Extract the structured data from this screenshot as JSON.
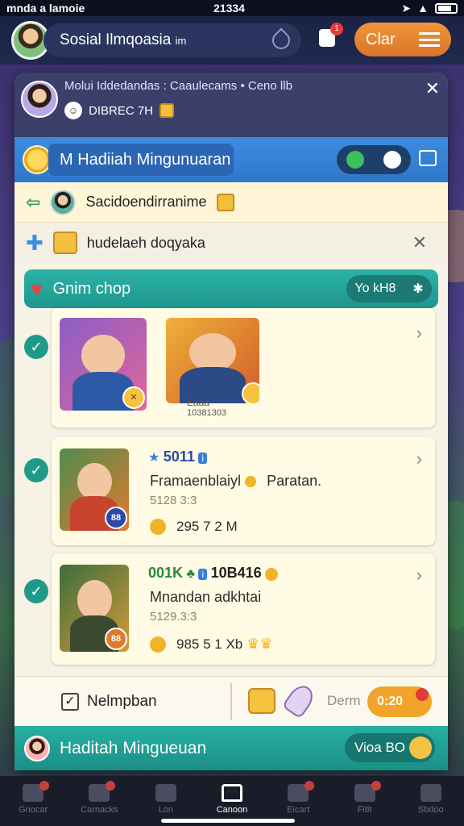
{
  "status_bar": {
    "left": "mnda a lamoie",
    "time": "21334"
  },
  "topbar": {
    "app_name": "Sosial Ilmqoasia",
    "app_suffix": "im",
    "chat_button": "Clar",
    "notif_count": "1"
  },
  "panel_header": {
    "line1": "Molui Iddedandas : Caaulecams • Ceno llb",
    "line2": "DIBREC 7H"
  },
  "title_bar": {
    "title": "Hadiiah Mingunuaran",
    "title_prefix": "M"
  },
  "rows": {
    "row_a": "Sacidoendirranime",
    "row_b": "hudelaeh doqyaka"
  },
  "group_bar": {
    "label": "Gnim chop",
    "pill_text": "Yo kH8"
  },
  "cards": [
    {
      "badge1": "✕",
      "badge2": "Eaaa",
      "caption": "10381303"
    },
    {
      "stat": "5011",
      "name": "Framaenblaiyl",
      "name2": "Paratan.",
      "meta": "5128 3:3",
      "value": "295 7 2 M",
      "thumb_badge": "88"
    },
    {
      "stat": "001K",
      "stat2": "10B416",
      "name": "Mnandan adkhtai",
      "meta": "5129.3:3",
      "value": "985 5 1 Xb",
      "thumb_badge": "88"
    }
  ],
  "footer": {
    "checkbox_label": "Nelmpban",
    "demo_label": "Derm",
    "pill_text": "0:20"
  },
  "bottom_banner": {
    "label": "Haditah Mingueuan",
    "pill_text": "Vioa BO"
  },
  "bottom_nav": [
    {
      "label": "Gnocar"
    },
    {
      "label": "Carnacks"
    },
    {
      "label": "Lon"
    },
    {
      "label": "Canoon"
    },
    {
      "label": "Eicart"
    },
    {
      "label": "Fitlt"
    },
    {
      "label": "Sbdoo"
    }
  ],
  "colors": {
    "accent_orange": "#f0963a",
    "teal": "#1f9a8a",
    "blue": "#2e77c9"
  }
}
